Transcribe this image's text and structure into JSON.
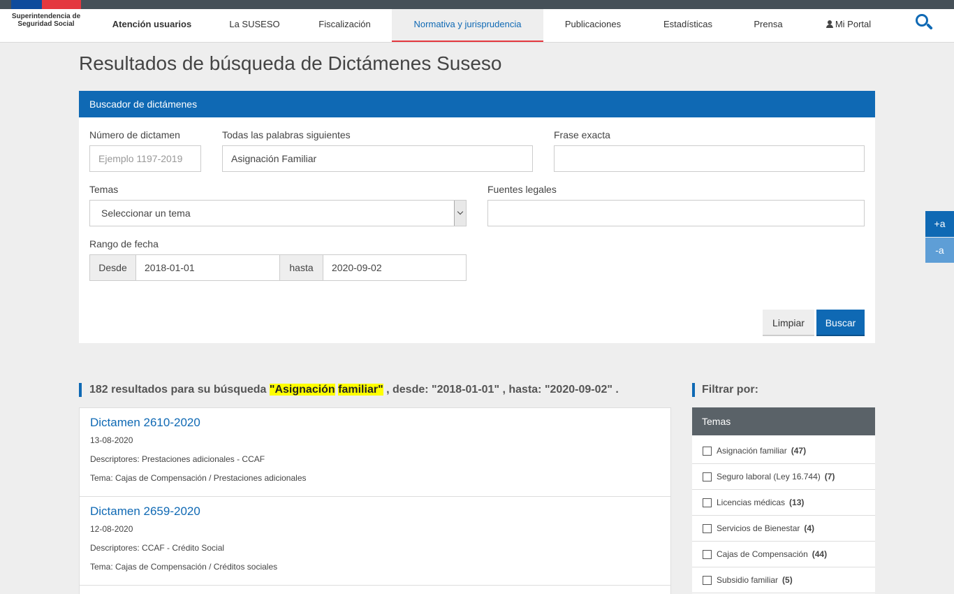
{
  "header": {
    "logo": "Superintendencia de Seguridad Social",
    "nav": [
      {
        "label": "Atención usuarios"
      },
      {
        "label": "La SUSESO"
      },
      {
        "label": "Fiscalización"
      },
      {
        "label": "Normativa y jurisprudencia"
      },
      {
        "label": "Publicaciones"
      },
      {
        "label": "Estadísticas"
      },
      {
        "label": "Prensa"
      },
      {
        "label": "Mi Portal"
      }
    ],
    "search_icon": "search-icon",
    "user_icon": "person-icon"
  },
  "page_title": "Resultados de búsqueda de Dictámenes Suseso",
  "search_panel": {
    "title": "Buscador de dictámenes",
    "numero_label": "Número de dictamen",
    "numero_placeholder": "Ejemplo 1197-2019",
    "palabras_label": "Todas las palabras siguientes",
    "palabras_value": "Asignación Familiar",
    "frase_label": "Frase exacta",
    "frase_value": "",
    "temas_label": "Temas",
    "temas_selected": "Seleccionar un tema",
    "fuentes_label": "Fuentes legales",
    "fuentes_value": "",
    "rango_label": "Rango de fecha",
    "desde_label": "Desde",
    "desde_value": "2018-01-01",
    "hasta_label": "hasta",
    "hasta_value": "2020-09-02",
    "clear_label": "Limpiar",
    "search_label": "Buscar"
  },
  "font_controls": {
    "increase": "+a",
    "decrease": "-a"
  },
  "results_header": {
    "prefix": "182 resultados para su búsqueda ",
    "quote_open": "\"",
    "term1": "Asignación",
    "term2": "familiar",
    "quote_close": "\"",
    "suffix": " , desde: \"2018-01-01\" , hasta: \"2020-09-02\" ."
  },
  "results": [
    {
      "title": "Dictamen 2610-2020",
      "date": "13-08-2020",
      "descriptores": "Descriptores: Prestaciones adicionales - CCAF",
      "tema": "Tema: Cajas de Compensación / Prestaciones adicionales"
    },
    {
      "title": "Dictamen 2659-2020",
      "date": "12-08-2020",
      "descriptores": "Descriptores: CCAF - Crédito Social",
      "tema": "Tema: Cajas de Compensación / Créditos sociales"
    }
  ],
  "filter": {
    "title": "Filtrar por:",
    "panel_title": "Temas",
    "items": [
      {
        "label": "Asignación familiar",
        "count": "(47)"
      },
      {
        "label": "Seguro laboral (Ley 16.744)",
        "count": "(7)"
      },
      {
        "label": "Licencias médicas",
        "count": "(13)"
      },
      {
        "label": "Servicios de Bienestar",
        "count": "(4)"
      },
      {
        "label": "Cajas de Compensación",
        "count": "(44)"
      },
      {
        "label": "Subsidio familiar",
        "count": "(5)"
      }
    ]
  },
  "colors": {
    "primary": "#0f69b4",
    "accent_red": "#e4383f",
    "highlight": "#ffff00"
  }
}
